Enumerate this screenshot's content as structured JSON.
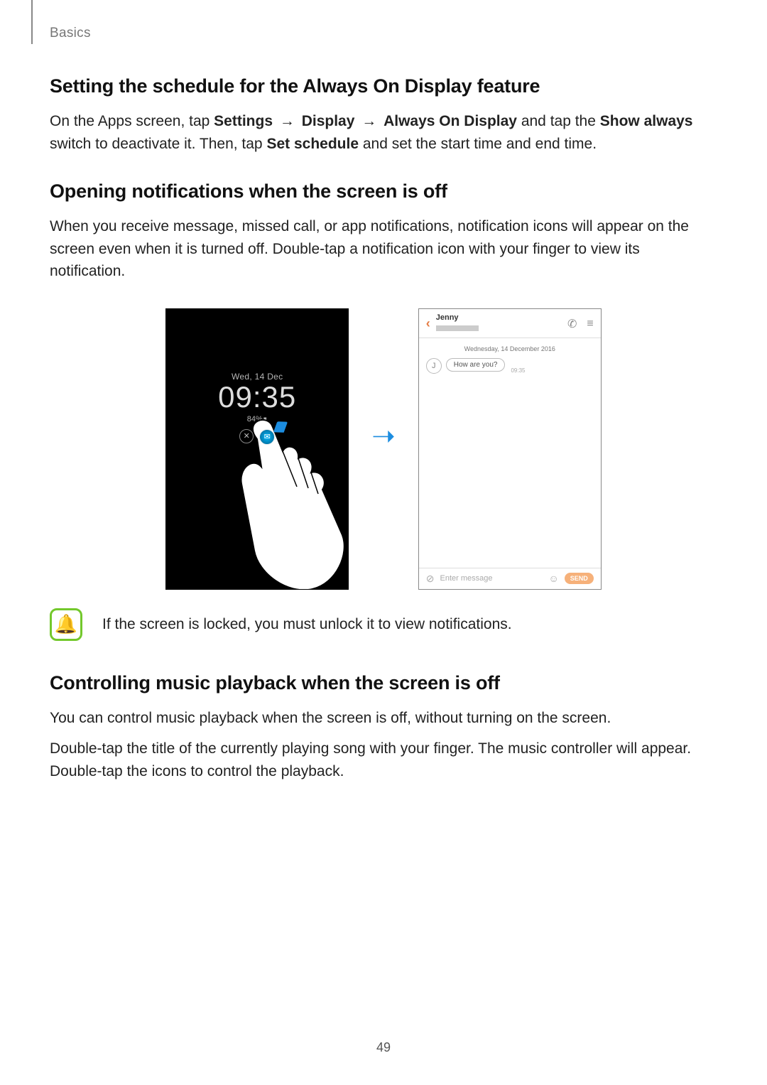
{
  "meta": {
    "section_label": "Basics",
    "page_number": "49"
  },
  "schedule": {
    "heading": "Setting the schedule for the Always On Display feature",
    "p1_a": "On the Apps screen, tap ",
    "p1_b_settings": "Settings",
    "p1_arrow": " → ",
    "p1_b_display": "Display",
    "p1_b_aod": "Always On Display",
    "p1_c": " and tap the ",
    "p1_b_showalways": "Show always",
    "p1_d": " switch to deactivate it. Then, tap ",
    "p1_b_setschedule": "Set schedule",
    "p1_e": " and set the start time and end time."
  },
  "notif": {
    "heading": "Opening notifications when the screen is off",
    "p1": "When you receive message, missed call, or app notifications, notification icons will appear on the screen even when it is turned off. Double-tap a notification icon with your finger to view its notification.",
    "aod": {
      "date": "Wed, 14 Dec",
      "time": "09:35",
      "battery": "84%∎"
    },
    "chat": {
      "contact": "Jenny",
      "date": "Wednesday, 14 December 2016",
      "avatar_initial": "J",
      "message": "How are you?",
      "msg_time": "09:35",
      "input_placeholder": "Enter message",
      "send_label": "SEND"
    },
    "note": "If the screen is locked, you must unlock it to view notifications."
  },
  "music": {
    "heading": "Controlling music playback when the screen is off",
    "p1": "You can control music playback when the screen is off, without turning on the screen.",
    "p2": "Double-tap the title of the currently playing song with your finger. The music controller will appear. Double-tap the icons to control the playback."
  }
}
